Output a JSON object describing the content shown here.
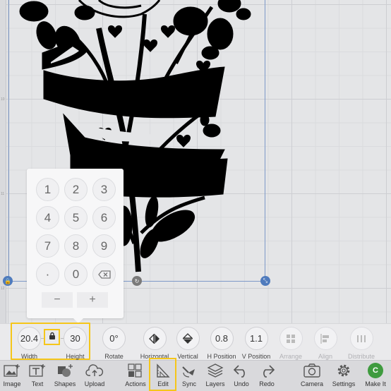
{
  "canvas": {
    "ruler_marks": [
      "10",
      "11",
      "12"
    ]
  },
  "keypad": {
    "keys": [
      "1",
      "2",
      "3",
      "4",
      "5",
      "6",
      "7",
      "8",
      "9",
      "·",
      "0"
    ],
    "backspace_icon": "backspace-icon",
    "minus": "−",
    "plus": "+"
  },
  "properties": {
    "width": {
      "value": "20.4",
      "label": "Width"
    },
    "height": {
      "value": "30",
      "label": "Height"
    },
    "rotate": {
      "value": "0°",
      "label": "Rotate"
    },
    "horizontal": {
      "label": "Horizontal",
      "icon": "flip-horizontal-icon"
    },
    "vertical": {
      "label": "Vertical",
      "icon": "flip-vertical-icon"
    },
    "h_position": {
      "value": "0.8",
      "label": "H Position"
    },
    "v_position": {
      "value": "1.1",
      "label": "V Position"
    },
    "arrange": {
      "label": "Arrange",
      "disabled": true
    },
    "align": {
      "label": "Align",
      "disabled": true
    },
    "distribute": {
      "label": "Distribute",
      "disabled": true
    }
  },
  "toolbar": {
    "image": "Image",
    "text": "Text",
    "shapes": "Shapes",
    "upload": "Upload",
    "actions": "Actions",
    "edit": "Edit",
    "sync": "Sync",
    "layers": "Layers",
    "undo": "Undo",
    "redo": "Redo",
    "camera": "Camera",
    "settings": "Settings",
    "make_it": "Make It",
    "make_it_badge": "C"
  },
  "colors": {
    "highlight": "#f5c61a",
    "handle_blue": "#4f7bbd",
    "make_it_green": "#3f9b3f"
  }
}
